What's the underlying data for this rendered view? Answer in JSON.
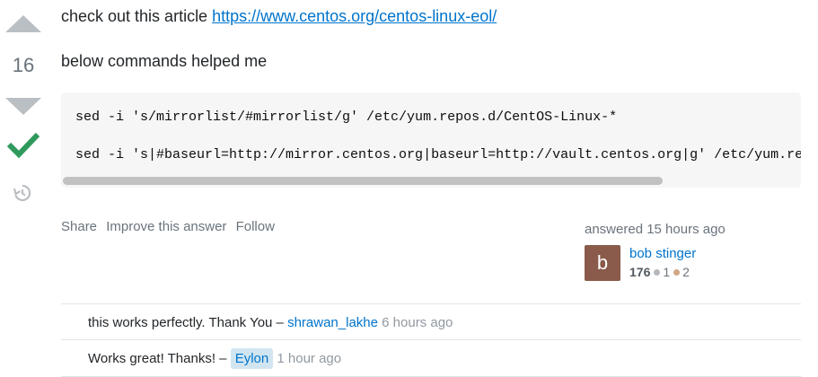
{
  "vote": {
    "count": "16"
  },
  "answer": {
    "line1_text": "check out this article ",
    "line1_link": "https://www.centos.org/centos-linux-eol/",
    "line2_text": "below commands helped me",
    "code_lines": [
      "sed -i 's/mirrorlist/#mirrorlist/g' /etc/yum.repos.d/CentOS-Linux-*",
      "sed -i 's|#baseurl=http://mirror.centos.org|baseurl=http://vault.centos.org|g' /etc/yum.repos.d/CentOS-Linux-*"
    ]
  },
  "menu": {
    "share": "Share",
    "improve": "Improve this answer",
    "follow": "Follow"
  },
  "user": {
    "answered_label": "answered 15 hours ago",
    "avatar_letter": "b",
    "name": "bob stinger",
    "reputation": "176",
    "silver": "1",
    "bronze": "2"
  },
  "comments": [
    {
      "text": "this works perfectly. Thank You – ",
      "user": "shrawan_lakhe",
      "time": " 6 hours ago"
    },
    {
      "text": "Works great! Thanks! – ",
      "user": "Eylon",
      "time": " 1 hour ago"
    }
  ],
  "colors": {
    "link": "#0074cc",
    "accepted": "#2f9a5c",
    "avatar": "#8a5b4a",
    "op_badge_bg": "#d1e5f1"
  }
}
